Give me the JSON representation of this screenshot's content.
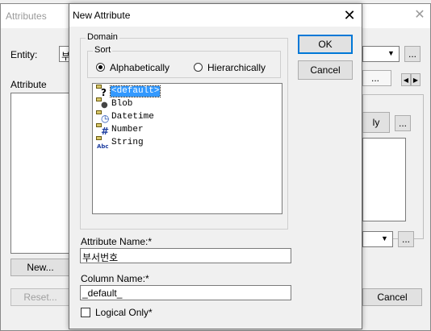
{
  "bg": {
    "title": "Attributes",
    "entity_label": "Entity:",
    "entity_value": "부",
    "attribute_label": "Attribute",
    "new_button": "New...",
    "reset_button": "Reset...",
    "cancel_button": "Cancel",
    "ellipsis": "...",
    "tab_dots": "...",
    "ly_button": "ly"
  },
  "dialog": {
    "title": "New Attribute",
    "domain_label": "Domain",
    "sort_label": "Sort",
    "sort_options": [
      "Alphabetically",
      "Hierarchically"
    ],
    "sort_selected": "Alphabetically",
    "ok_button": "OK",
    "cancel_button": "Cancel",
    "domains": [
      {
        "label": "<default>",
        "icon": "question-icon",
        "glyph": "?",
        "glyph_color": "#000000"
      },
      {
        "label": "Blob",
        "icon": "blob-icon",
        "glyph": "●",
        "glyph_color": "#444444"
      },
      {
        "label": "Datetime",
        "icon": "clock-icon",
        "glyph": "◷",
        "glyph_color": "#1f4fb0"
      },
      {
        "label": "Number",
        "icon": "number-icon",
        "glyph": "#",
        "glyph_color": "#1f3fa0"
      },
      {
        "label": "String",
        "icon": "string-icon",
        "glyph": "Abc",
        "glyph_color": "#1f3fa0"
      }
    ],
    "selected_domain": "<default>",
    "attribute_name_label": "Attribute Name:*",
    "attribute_name_value": "부서번호",
    "column_name_label": "Column Name:*",
    "column_name_value": "_default_",
    "logical_only_label": "Logical Only*",
    "logical_only_checked": false
  }
}
